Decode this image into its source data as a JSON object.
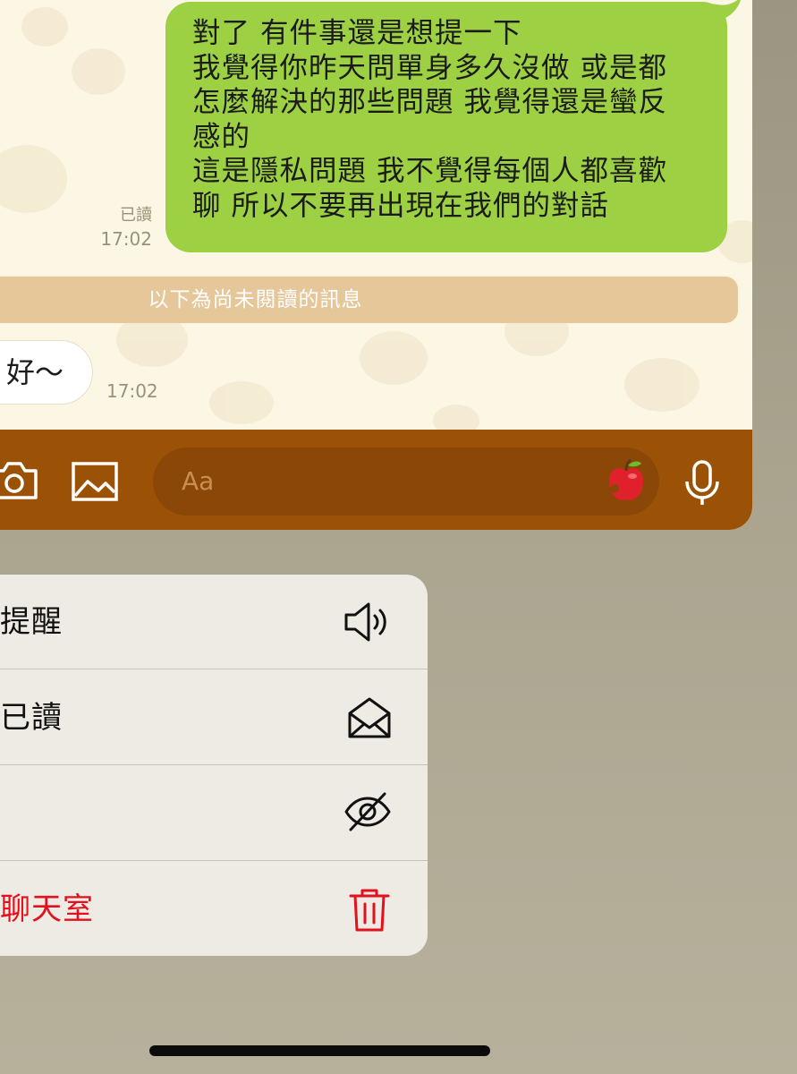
{
  "chat": {
    "sent_message_lines": [
      "對了 有件事還是想提一下",
      "我覺得你昨天問單身多久沒做 或是都",
      "怎麼解決的那些問題 我覺得還是蠻反",
      "感的",
      "這是隱私問題 我不覺得每個人都喜歡",
      "聊 所以不要再出現在我們的對話"
    ],
    "sent_read_label": "已讀",
    "sent_time": "17:02",
    "unread_divider": "以下為尚未閱讀的訊息",
    "received_message": "好～",
    "received_time": "17:02"
  },
  "input_bar": {
    "placeholder": "Aa",
    "icons": [
      "camera-icon",
      "image-icon",
      "apple-sticker-icon",
      "microphone-icon"
    ]
  },
  "menu": {
    "items": [
      {
        "label": "提醒",
        "icon": "speaker-icon",
        "danger": false
      },
      {
        "label": "已讀",
        "icon": "open-envelope-icon",
        "danger": false
      },
      {
        "label": "",
        "icon": "eye-slash-icon",
        "danger": false
      },
      {
        "label": "聊天室",
        "icon": "trash-icon",
        "danger": true
      }
    ]
  },
  "colors": {
    "sent_bubble": "#9dd143",
    "chat_background": "#fcf6e4",
    "unread_divider": "#e5c79a",
    "input_bar": "#9c5206",
    "menu_background": "#eeeae4",
    "danger": "#e3101e"
  }
}
